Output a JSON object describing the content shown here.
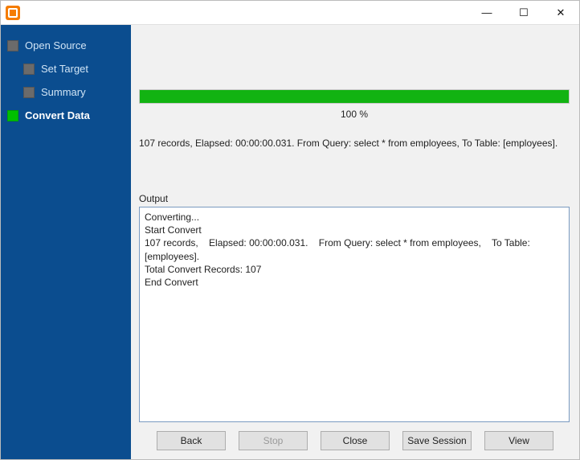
{
  "window": {
    "minimize_glyph": "—",
    "maximize_glyph": "☐",
    "close_glyph": "✕"
  },
  "sidebar": {
    "items": [
      {
        "label": "Open Source",
        "active": false,
        "child": false
      },
      {
        "label": "Set Target",
        "active": false,
        "child": true
      },
      {
        "label": "Summary",
        "active": false,
        "child": true
      },
      {
        "label": "Convert Data",
        "active": true,
        "child": false
      }
    ]
  },
  "progress": {
    "percent_label": "100 %",
    "fill_color": "#12b312"
  },
  "status_line": "107 records,    Elapsed: 00:00:00.031.    From Query: select * from employees,    To Table: [employees].",
  "output": {
    "label": "Output",
    "text": "Converting...\nStart Convert\n107 records,    Elapsed: 00:00:00.031.    From Query: select * from employees,    To Table: [employees].\nTotal Convert Records: 107\nEnd Convert\n"
  },
  "buttons": {
    "back": "Back",
    "stop": "Stop",
    "close": "Close",
    "save_session": "Save Session",
    "view": "View"
  }
}
